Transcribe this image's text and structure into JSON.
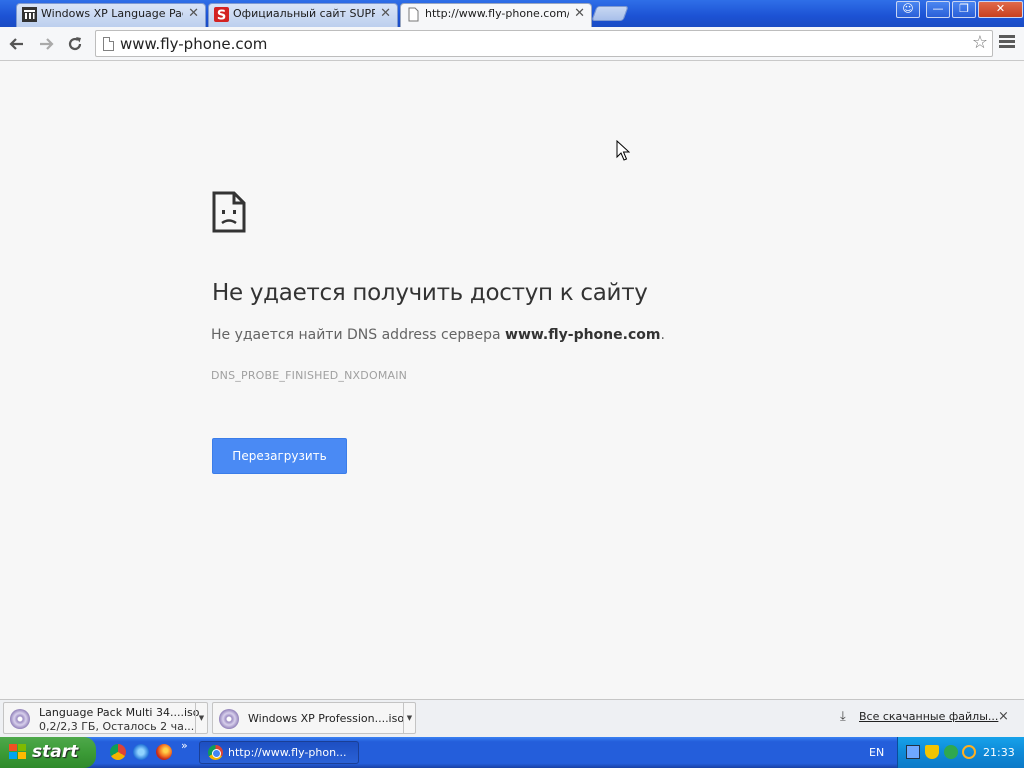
{
  "browser": {
    "tabs": [
      {
        "label": "Windows XP Language Pack",
        "active": false,
        "favicon": "library-icon"
      },
      {
        "label": "Официальный сайт SUPRA",
        "active": false,
        "favicon": "supra-s-icon"
      },
      {
        "label": "http://www.fly-phone.com/",
        "active": true,
        "favicon": "page-icon"
      }
    ],
    "url": "www.fly-phone.com",
    "colors": {
      "titlebar": "#2f6fe8",
      "accent": "#4a8af4"
    }
  },
  "error": {
    "title": "Не удается получить доступ к сайту",
    "desc_prefix": "Не удается найти DNS address сервера ",
    "desc_host": "www.fly-phone.com",
    "desc_suffix": ".",
    "code": "DNS_PROBE_FINISHED_NXDOMAIN",
    "reload_label": "Перезагрузить",
    "icon": "sad-page-icon"
  },
  "downloads": {
    "items": [
      {
        "name": "Language Pack Multi 34....iso",
        "status": "0,2/2,3 ГБ, Осталось 2 ча..."
      },
      {
        "name": "Windows XP Profession....iso",
        "status": ""
      }
    ],
    "all_label": "Все скачанные файлы...",
    "close_symbol": "×"
  },
  "taskbar": {
    "start_label": "start",
    "more_symbol": "»",
    "task_label": "http://www.fly-phon...",
    "language": "EN",
    "clock": "21:33"
  }
}
